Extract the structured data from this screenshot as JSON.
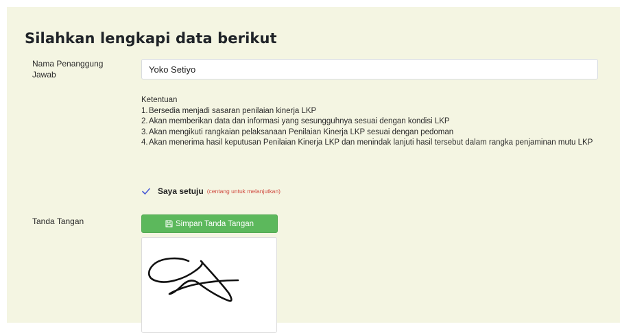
{
  "form": {
    "title": "Silahkan lengkapi data berikut",
    "name_field": {
      "label": "Nama Penanggung Jawab",
      "value": "Yoko Setiyo"
    },
    "terms": {
      "heading": "Ketentuan",
      "items": [
        {
          "number": "1.",
          "text": "Bersedia menjadi sasaran penilaian kinerja LKP"
        },
        {
          "number": "2.",
          "text": "Akan memberikan data dan informasi yang sesungguhnya sesuai dengan kondisi LKP"
        },
        {
          "number": "3.",
          "text": "Akan mengikuti rangkaian pelaksanaan Penilaian Kinerja LKP sesuai dengan pedoman"
        },
        {
          "number": "4.",
          "text": "Akan menerima hasil keputusan Penilaian Kinerja LKP dan menindak lanjuti hasil tersebut dalam rangka penjaminan mutu LKP"
        }
      ]
    },
    "agreement": {
      "label": "Saya setuju",
      "hint": "(centang untuk melanjutkan)",
      "checked": true
    },
    "signature": {
      "label": "Tanda Tangan",
      "save_button_label": "Simpan Tanda Tangan",
      "save_icon": "floppy-disk-icon"
    }
  },
  "colors": {
    "panel_background": "#f4f5e2",
    "save_button": "#5cb85c",
    "hint_text": "#d0493f",
    "checkmark": "#4a5bd6"
  }
}
